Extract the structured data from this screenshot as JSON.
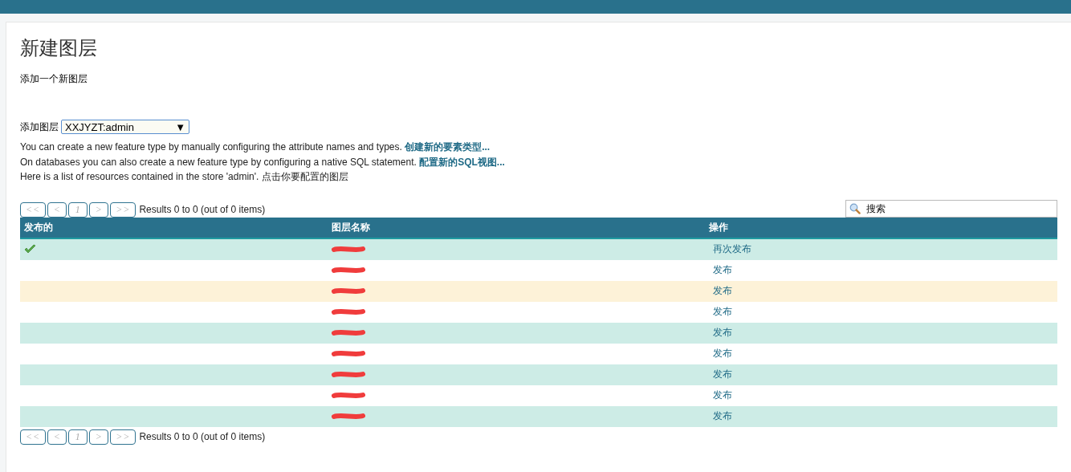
{
  "page": {
    "title": "新建图层",
    "subtitle": "添加一个新图层"
  },
  "add_layer": {
    "label": "添加图层",
    "value": "XXJYZT:admin",
    "arrow": "▼"
  },
  "info": [
    {
      "text": "You can create a new feature type by manually configuring the attribute names and types.",
      "link": "创建新的要素类型..."
    },
    {
      "text": "On databases you can also create a new feature type by configuring a native SQL statement.",
      "link": "配置新的SQL视图..."
    },
    {
      "text": "Here is a list of resources contained in the store 'admin'. 点击你要配置的图层"
    }
  ],
  "pager_top": {
    "buttons": [
      {
        "label": "<<",
        "disabled": true
      },
      {
        "label": "<",
        "disabled": true
      },
      {
        "label": "1",
        "disabled": true
      },
      {
        "label": ">",
        "disabled": true
      },
      {
        "label": ">>",
        "disabled": true
      }
    ],
    "summary": "Results 0 to 0 (out of 0 items)"
  },
  "search": {
    "placeholder": "搜索"
  },
  "table": {
    "columns": [
      "发布的",
      "图层名称",
      "操作"
    ],
    "rows": [
      {
        "published": true,
        "name_redacted": true,
        "action": "再次发布",
        "highlighted": false
      },
      {
        "published": false,
        "name_redacted": true,
        "action": "发布",
        "highlighted": false
      },
      {
        "published": false,
        "name_redacted": true,
        "action": "发布",
        "highlighted": true
      },
      {
        "published": false,
        "name_redacted": true,
        "action": "发布",
        "highlighted": false
      },
      {
        "published": false,
        "name_redacted": true,
        "action": "发布",
        "highlighted": false
      },
      {
        "published": false,
        "name_redacted": true,
        "action": "发布",
        "highlighted": false
      },
      {
        "published": false,
        "name_redacted": true,
        "action": "发布",
        "highlighted": false
      },
      {
        "published": false,
        "name_redacted": true,
        "action": "发布",
        "highlighted": false
      },
      {
        "published": false,
        "name_redacted": true,
        "action": "发布",
        "highlighted": false
      }
    ]
  },
  "pager_bottom": {
    "buttons": [
      {
        "label": "<<",
        "disabled": true
      },
      {
        "label": "<",
        "disabled": true
      },
      {
        "label": "1",
        "disabled": true
      },
      {
        "label": ">",
        "disabled": true
      },
      {
        "label": ">>",
        "disabled": true
      }
    ],
    "summary": "Results 0 to 0 (out of 0 items)"
  }
}
